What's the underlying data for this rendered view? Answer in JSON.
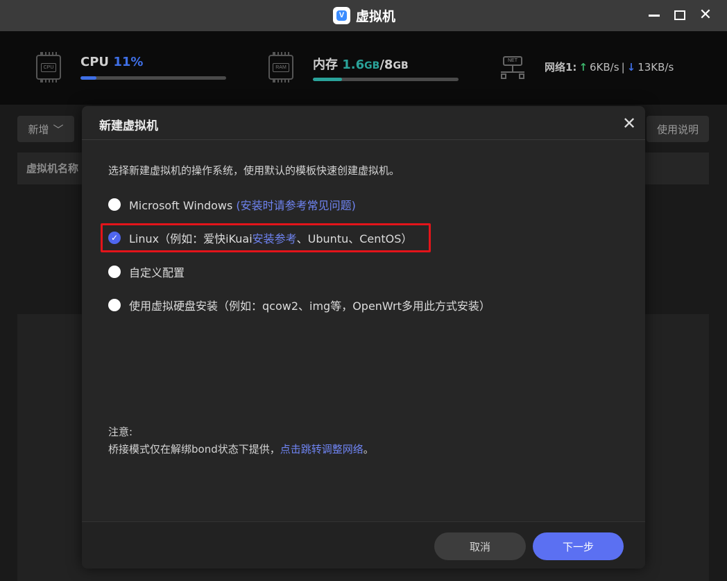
{
  "window": {
    "title": "虚拟机",
    "logo_letter": "V"
  },
  "stats": {
    "cpu": {
      "label": "CPU",
      "value": "11%",
      "percent": 11,
      "chip_label": "CPU"
    },
    "memory": {
      "label": "内存",
      "used": "1.6",
      "used_unit": "GB",
      "separator": "/",
      "total": "8",
      "total_unit": "GB",
      "percent": 20,
      "chip_label": "RAM"
    },
    "network": {
      "label": "网络1:",
      "up": "6KB/s",
      "down": "13KB/s",
      "separator": "|",
      "icon_label": "NET"
    }
  },
  "background": {
    "add_button": "新增",
    "help_button": "使用说明",
    "table_header": "虚拟机名称"
  },
  "dialog": {
    "title": "新建虚拟机",
    "description": "选择新建虚拟机的操作系统，使用默认的模板快速创建虚拟机。",
    "options": [
      {
        "label": "Microsoft Windows",
        "link": "(安装时请参考常见问题)",
        "checked": false
      },
      {
        "label_pre": "Linux（例如：爱快iKuai",
        "link": "安装参考",
        "label_post": "、Ubuntu、CentOS）",
        "checked": true
      },
      {
        "label": "自定义配置",
        "checked": false
      },
      {
        "label": "使用虚拟硬盘安装（例如：qcow2、img等，OpenWrt多用此方式安装）",
        "checked": false
      }
    ],
    "note_title": "注意:",
    "note_text": "桥接模式仅在解绑bond状态下提供，",
    "note_link": "点击跳转调整网络",
    "note_end": "。",
    "cancel_button": "取消",
    "next_button": "下一步"
  },
  "colors": {
    "accent": "#5b70f2",
    "link": "#6f84f2",
    "cpu_value": "#3f6fe6",
    "memory_value": "#2aa39a",
    "upload": "#3bb36a",
    "highlight": "#e3141a"
  }
}
